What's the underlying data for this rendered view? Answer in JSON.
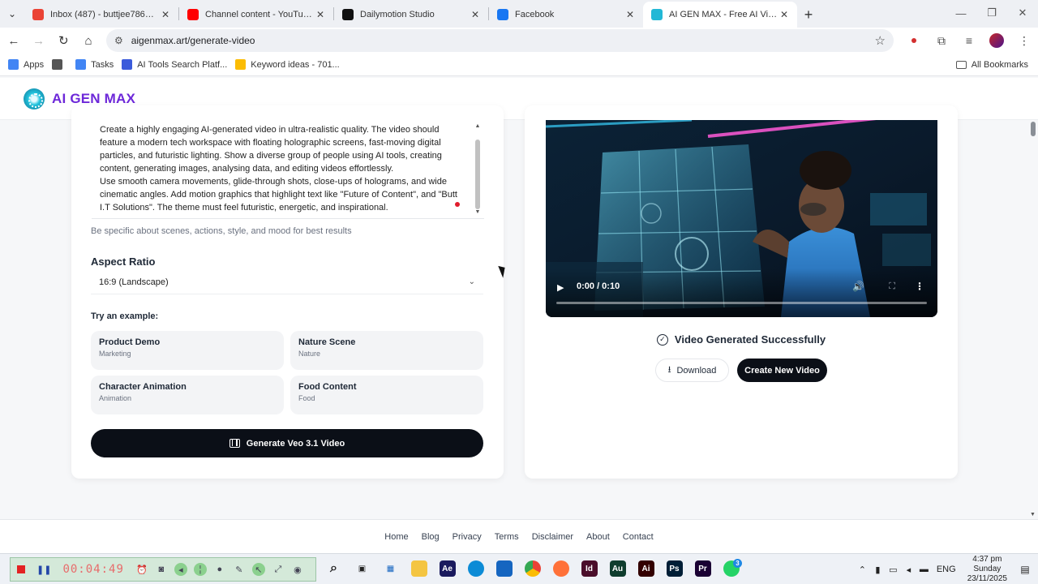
{
  "browser": {
    "tabs": [
      {
        "title": "Inbox (487) - buttjee786@gmail.com",
        "icon": "gmail-icon",
        "color": "#ea4335",
        "active": false
      },
      {
        "title": "Channel content - YouTube Studio",
        "icon": "youtube-icon",
        "color": "#ff0000",
        "active": false
      },
      {
        "title": "Dailymotion Studio",
        "icon": "dailymotion-icon",
        "color": "#111111",
        "active": false
      },
      {
        "title": "Facebook",
        "icon": "facebook-icon",
        "color": "#1877f2",
        "active": false
      },
      {
        "title": "AI GEN MAX - Free AI Video Generator",
        "icon": "aigenmax-icon",
        "color": "#22b8d6",
        "active": true
      }
    ],
    "url": "aigenmax.art/generate-video",
    "bookmarks": [
      {
        "label": "Apps",
        "icon": "apps-grid-icon",
        "color": "#4285f4"
      },
      {
        "label": "",
        "icon": "grid-icon",
        "color": "#555555"
      },
      {
        "label": "Tasks",
        "icon": "tasks-icon",
        "color": "#4285f4"
      },
      {
        "label": "AI Tools Search Platf...",
        "icon": "ai-tools-icon",
        "color": "#3b5bdb"
      },
      {
        "label": "Keyword ideas - 701...",
        "icon": "google-ads-icon",
        "color": "#fbbc04"
      }
    ],
    "all_bookmarks": "All Bookmarks"
  },
  "site": {
    "brand": "AI GEN MAX",
    "brand_color": "#6d28d9"
  },
  "form": {
    "prompt_lines": [
      "Create a highly engaging AI-generated video in ultra-realistic quality. The video should feature a modern tech workspace with floating holographic screens, fast-moving digital particles, and futuristic lighting. Show a diverse group of people using AI tools, creating content, generating images, analysing data, and editing videos effortlessly.",
      "Use smooth camera movements, glide-through shots, close-ups of holograms, and wide cinematic angles. Add motion graphics that highlight text like \"Future of Content\", and \"Butt I.T Solutions\". The theme must feel futuristic, energetic, and inspirational."
    ],
    "hint": "Be specific about scenes, actions, style, and mood for best results",
    "aspect_ratio_label": "Aspect Ratio",
    "aspect_ratio_value": "16:9 (Landscape)",
    "try_label": "Try an example:",
    "examples": [
      {
        "title": "Product Demo",
        "category": "Marketing"
      },
      {
        "title": "Nature Scene",
        "category": "Nature"
      },
      {
        "title": "Character Animation",
        "category": "Animation"
      },
      {
        "title": "Food Content",
        "category": "Food"
      }
    ],
    "generate_label": "Generate Veo 3.1 Video"
  },
  "result": {
    "player_time": "0:00 / 0:10",
    "progress": 0,
    "status": "Video Generated Successfully",
    "download_label": "Download",
    "new_label": "Create New Video"
  },
  "footer": {
    "links": [
      "Home",
      "Blog",
      "Privacy",
      "Terms",
      "Disclaimer",
      "About",
      "Contact"
    ]
  },
  "taskbar": {
    "recorder_time": "00:04:49",
    "apps": [
      {
        "icon": "search-icon",
        "label": "",
        "color": "#00000000"
      },
      {
        "icon": "task-view-icon",
        "label": "",
        "color": "#00000000"
      },
      {
        "icon": "widgets-icon",
        "label": "",
        "color": "#00000000"
      },
      {
        "icon": "file-explorer-icon",
        "label": "",
        "color": "#f4c542"
      },
      {
        "icon": "after-effects-icon",
        "label": "Ae",
        "color": "#1a1a5e"
      },
      {
        "icon": "edge-icon",
        "label": "",
        "color": "#0c8bd6"
      },
      {
        "icon": "store-icon",
        "label": "",
        "color": "#1565c0"
      },
      {
        "icon": "chrome-icon",
        "label": "",
        "color": "#34a853"
      },
      {
        "icon": "firefox-icon",
        "label": "",
        "color": "#ff7139"
      },
      {
        "icon": "indesign-icon",
        "label": "Id",
        "color": "#4a0e2a"
      },
      {
        "icon": "audition-icon",
        "label": "Au",
        "color": "#0f3d2e"
      },
      {
        "icon": "illustrator-icon",
        "label": "Ai",
        "color": "#330000"
      },
      {
        "icon": "photoshop-icon",
        "label": "Ps",
        "color": "#001e36"
      },
      {
        "icon": "premiere-icon",
        "label": "Pr",
        "color": "#1a0033"
      },
      {
        "icon": "whatsapp-icon",
        "label": "",
        "color": "#25d366"
      }
    ],
    "language": "ENG",
    "time": "4:37 pm",
    "day": "Sunday",
    "date": "23/11/2025",
    "whatsapp_badge": "3"
  }
}
